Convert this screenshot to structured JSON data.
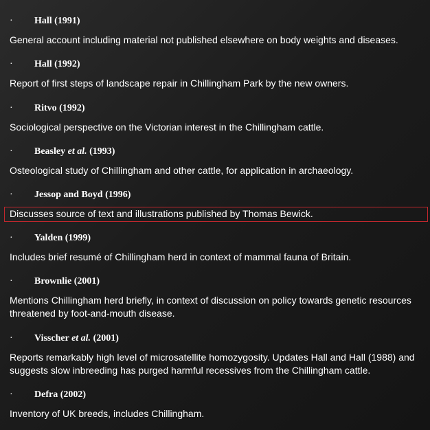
{
  "top_fragment": "...",
  "entries": [
    {
      "bullet": "·",
      "author": "Hall",
      "etal": "",
      "year": "(1991)",
      "description": "General account including material not published elsewhere on body weights and diseases."
    },
    {
      "bullet": "·",
      "author": "Hall",
      "etal": "",
      "year": "(1992)",
      "description": "Report of first steps of landscape repair in Chillingham Park by the new owners."
    },
    {
      "bullet": "·",
      "author": "Ritvo",
      "etal": "",
      "year": "(1992)",
      "description": "Sociological perspective on the Victorian interest in the Chillingham cattle."
    },
    {
      "bullet": "·",
      "author": "Beasley",
      "etal": "et al.",
      "year": "(1993)",
      "description": "Osteological study of Chillingham and other cattle, for application in archaeology."
    },
    {
      "bullet": "·",
      "author": "Jessop and Boyd",
      "etal": "",
      "year": "(1996)",
      "description": "Discusses source of text and illustrations published by Thomas Bewick."
    },
    {
      "bullet": "·",
      "author": "Yalden",
      "etal": "",
      "year": "(1999)",
      "description": "Includes brief resumé of Chillingham herd in context of mammal fauna of Britain."
    },
    {
      "bullet": "·",
      "author": "Brownlie",
      "etal": "",
      "year": "(2001)",
      "description": "Mentions Chillingham herd briefly, in context of discussion on policy towards genetic resources threatened by foot-and-mouth disease."
    },
    {
      "bullet": "·",
      "author": "Visscher",
      "etal": "et al.",
      "year": "(2001)",
      "description": "Reports remarkably high level of microsatellite homozygosity. Updates Hall and Hall (1988) and suggests slow inbreeding has purged harmful recessives from the Chillingham cattle."
    },
    {
      "bullet": "·",
      "author": "Defra",
      "etal": "",
      "year": "(2002)",
      "description": "Inventory of UK breeds, includes Chillingham."
    }
  ]
}
